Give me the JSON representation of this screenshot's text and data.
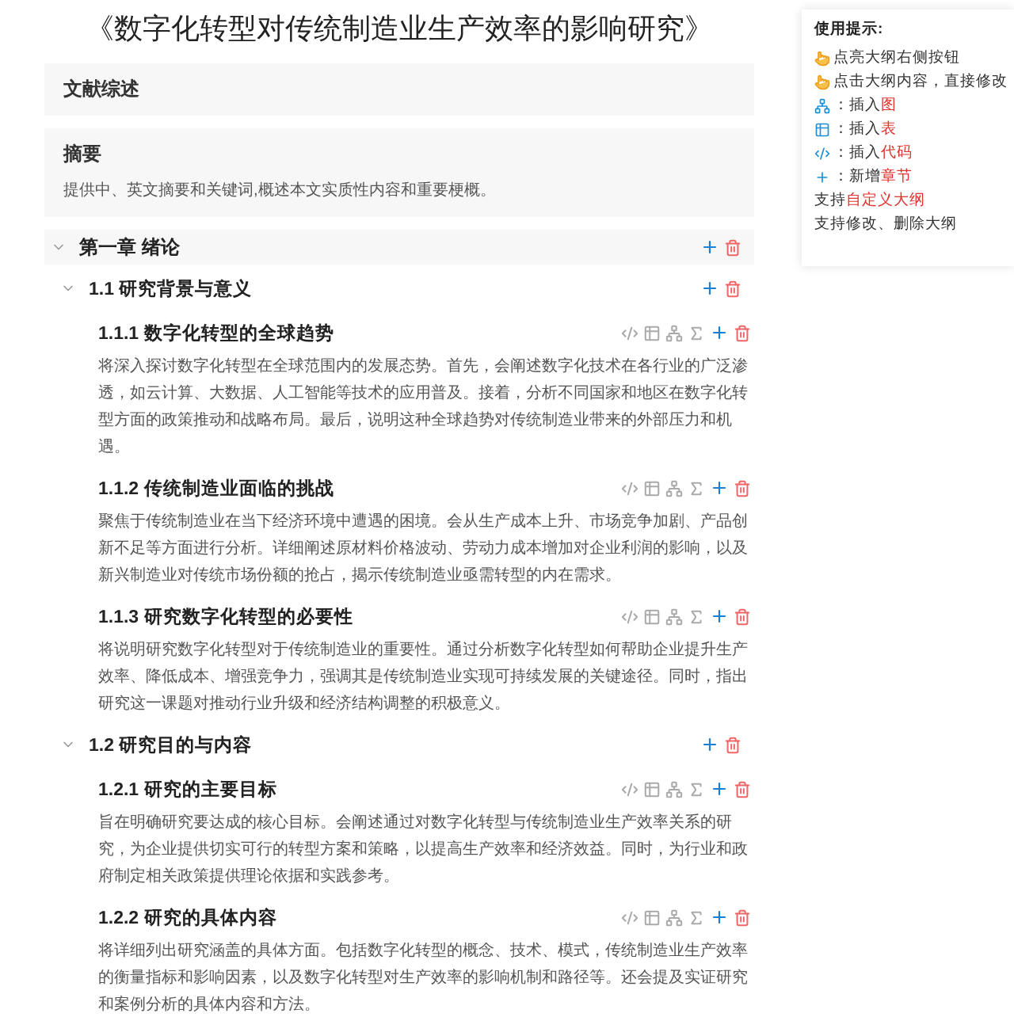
{
  "title": "《数字化转型对传统制造业生产效率的影响研究》",
  "top_sections": [
    {
      "heading": "文献综述"
    },
    {
      "heading": "摘要",
      "body": "提供中、英文摘要和关键词,概述本文实质性内容和重要梗概。"
    }
  ],
  "outline": [
    {
      "heading": "第一章 绪论",
      "expanded": true,
      "children": [
        {
          "heading": "1.1 研究背景与意义",
          "expanded": true,
          "children": [
            {
              "heading": "1.1.1 数字化转型的全球趋势",
              "body": "将深入探讨数字化转型在全球范围内的发展态势。首先，会阐述数字化技术在各行业的广泛渗透，如云计算、大数据、人工智能等技术的应用普及。接着，分析不同国家和地区在数字化转型方面的政策推动和战略布局。最后，说明这种全球趋势对传统制造业带来的外部压力和机遇。"
            },
            {
              "heading": "1.1.2 传统制造业面临的挑战",
              "body": "聚焦于传统制造业在当下经济环境中遭遇的困境。会从生产成本上升、市场竞争加剧、产品创新不足等方面进行分析。详细阐述原材料价格波动、劳动力成本增加对企业利润的影响，以及新兴制造业对传统市场份额的抢占，揭示传统制造业亟需转型的内在需求。"
            },
            {
              "heading": "1.1.3 研究数字化转型的必要性",
              "body": "将说明研究数字化转型对于传统制造业的重要性。通过分析数字化转型如何帮助企业提升生产效率、降低成本、增强竞争力，强调其是传统制造业实现可持续发展的关键途径。同时，指出研究这一课题对推动行业升级和经济结构调整的积极意义。"
            }
          ]
        },
        {
          "heading": "1.2 研究目的与内容",
          "expanded": true,
          "children": [
            {
              "heading": "1.2.1 研究的主要目标",
              "body": "旨在明确研究要达成的核心目标。会阐述通过对数字化转型与传统制造业生产效率关系的研究，为企业提供切实可行的转型方案和策略，以提高生产效率和经济效益。同时，为行业和政府制定相关政策提供理论依据和实践参考。"
            },
            {
              "heading": "1.2.2 研究的具体内容",
              "body": "将详细列出研究涵盖的具体方面。包括数字化转型的概念、技术、模式，传统制造业生产效率的衡量指标和影响因素，以及数字化转型对生产效率的影响机制和路径等。还会提及实证研究和案例分析的具体内容和方法。"
            }
          ]
        }
      ]
    }
  ],
  "tips": {
    "title": "使用提示:",
    "items": [
      {
        "kind": "hand",
        "text": "点亮大纲右侧按钮"
      },
      {
        "kind": "hand",
        "text": "点击大纲内容，直接修改"
      },
      {
        "kind": "tree",
        "text": "：插入",
        "highlight": "图"
      },
      {
        "kind": "table",
        "text": "：插入",
        "highlight": "表"
      },
      {
        "kind": "code",
        "text": "：插入",
        "highlight": "代码"
      },
      {
        "kind": "plus",
        "text": "：新增",
        "highlight": "章节"
      },
      {
        "kind": "plain",
        "text": "支持",
        "highlight": "自定义大纲"
      },
      {
        "kind": "plain",
        "text": "支持修改、删除大纲"
      }
    ]
  }
}
